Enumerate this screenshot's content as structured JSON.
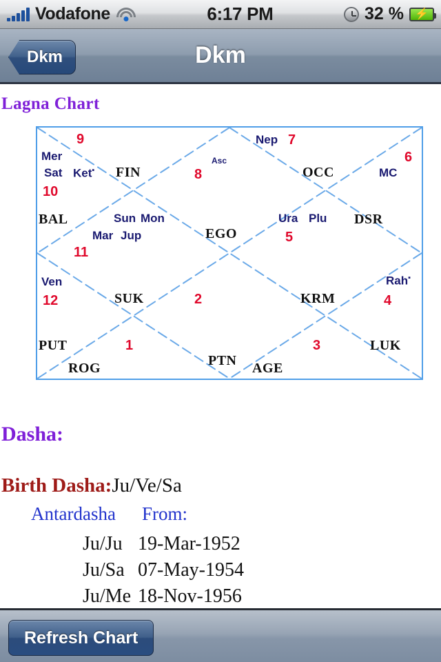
{
  "status_bar": {
    "signal_icon": "signal-bars-icon",
    "carrier": "Vodafone",
    "wifi_icon": "wifi-icon",
    "time": "6:17 PM",
    "alarm_icon": "alarm-clock-icon",
    "battery_percent": "32 %",
    "battery_icon": "battery-charging-icon",
    "bolt": "⚡"
  },
  "nav_bar": {
    "back_label": "Dkm",
    "title": "Dkm"
  },
  "content": {
    "section_title": "Lagna Chart"
  },
  "chart_data": {
    "type": "table",
    "title": "Lagna Chart",
    "style": "north-indian-vedic-diamond",
    "frame_color": "#4f9ee8",
    "house_number_color": "#E0092C",
    "planet_color": "#191970",
    "house_name_color": "#111111",
    "houses": [
      {
        "number": "1",
        "name": "SUK",
        "planets": []
      },
      {
        "number": "2",
        "name": "PTN",
        "planets": []
      },
      {
        "number": "3",
        "name": "KRM",
        "planets": []
      },
      {
        "number": "4",
        "name": "LUK",
        "planets": [
          "Rah"
        ]
      },
      {
        "number": "5",
        "name": "DSR",
        "planets": [
          "Ura",
          "Plu"
        ]
      },
      {
        "number": "6",
        "name": "MC",
        "planets": []
      },
      {
        "number": "7",
        "name": "OCC",
        "planets": [
          "Nep"
        ]
      },
      {
        "number": "8",
        "name": "FIN",
        "planets": [
          "Asc"
        ]
      },
      {
        "number": "9",
        "name": "BAL",
        "planets": [
          "Mer",
          "Sat",
          "Ket"
        ]
      },
      {
        "number": "10",
        "name": "PUT",
        "planets": []
      },
      {
        "number": "11",
        "name": "ROG",
        "planets": [
          "Sun",
          "Mon",
          "Mar",
          "Jup"
        ]
      },
      {
        "number": "12",
        "name": "AGE",
        "planets": [
          "Ven"
        ]
      }
    ],
    "house_names_all": [
      "FIN",
      "OCC",
      "MC",
      "DSR",
      "KRM",
      "LUK",
      "AGE",
      "PTN",
      "ROG",
      "PUT",
      "SUK",
      "BAL",
      "EGO"
    ],
    "labels": {
      "asc": "Asc",
      "ego": "EGO",
      "fin": "FIN",
      "occ": "OCC",
      "mc": "MC",
      "dsr": "DSR",
      "krm": "KRM",
      "luk": "LUK",
      "age": "AGE",
      "ptn": "PTN",
      "rog": "ROG",
      "put": "PUT",
      "suk": "SUK",
      "bal": "BAL",
      "n1": "1",
      "n2": "2",
      "n3": "3",
      "n4": "4",
      "n5": "5",
      "n6": "6",
      "n7": "7",
      "n8": "8",
      "n9": "9",
      "n10": "10",
      "n11": "11",
      "n12": "12",
      "mer": "Mer",
      "sat": "Sat",
      "ket": "Ket",
      "nep": "Nep",
      "ura": "Ura",
      "plu": "Plu",
      "sun": "Sun",
      "mon": "Mon",
      "mar": "Mar",
      "jup": "Jup",
      "ven": "Ven",
      "rah": "Rah",
      "retro_mark": "▪"
    }
  },
  "dasha": {
    "heading": "Dasha:",
    "birth_label": "Birth Dasha:",
    "birth_value": "Ju/Ve/Sa",
    "col_antardasha": "Antardasha",
    "col_from": "From:",
    "rows": [
      {
        "name": "Ju/Ju",
        "date": "19-Mar-1952"
      },
      {
        "name": "Ju/Sa",
        "date": "07-May-1954"
      },
      {
        "name": "Ju/Me",
        "date": "18-Nov-1956"
      }
    ]
  },
  "toolbar": {
    "refresh_label": "Refresh Chart"
  }
}
